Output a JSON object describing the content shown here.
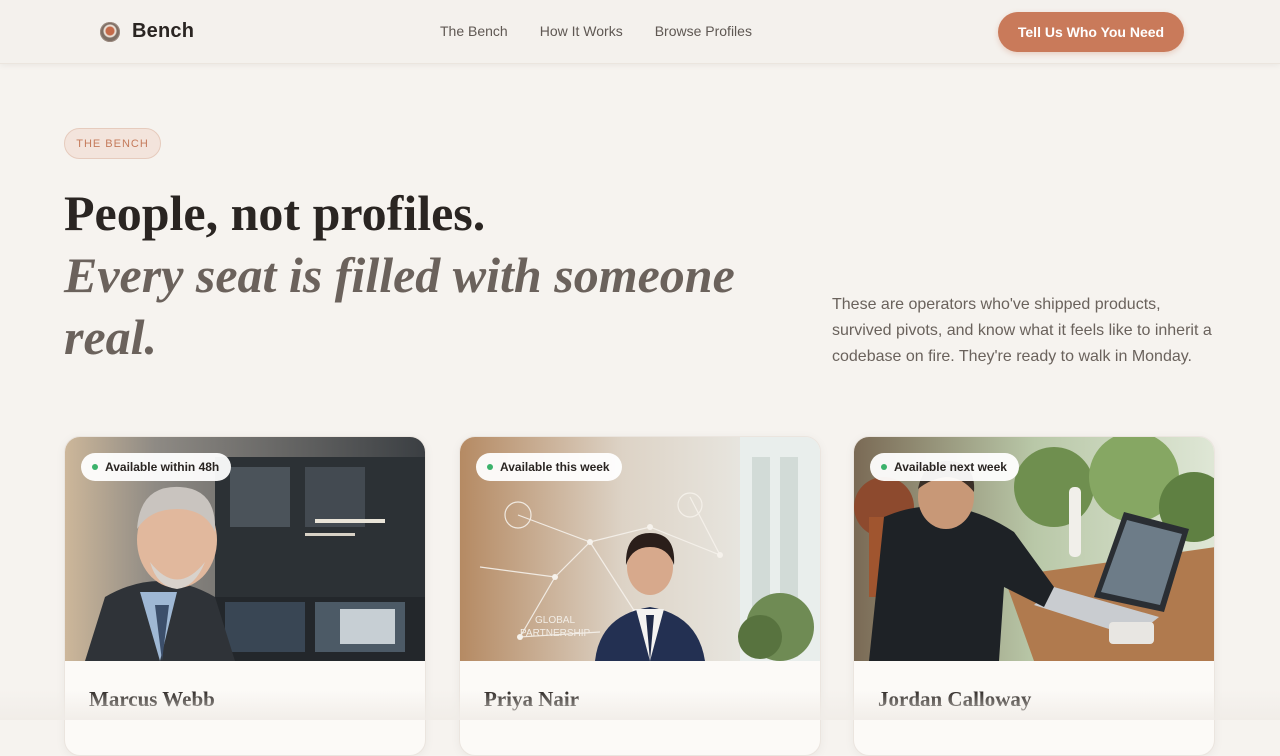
{
  "nav": {
    "brand": "Bench",
    "links": [
      "The Bench",
      "How It Works",
      "Browse Profiles"
    ],
    "cta": "Tell Us Who You Need"
  },
  "hero": {
    "eyebrow": "THE BENCH",
    "headline": "People, not profiles.",
    "subheadline": "Every seat is filled with someone real.",
    "lede": "These are operators who've shipped products, survived pivots, and know what it feels like to inherit a codebase on fire. They're ready to walk in Monday."
  },
  "cards": [
    {
      "badge": "Available within 48h",
      "name": "Marcus Webb"
    },
    {
      "badge": "Available this week",
      "name": "Priya Nair"
    },
    {
      "badge": "Available next week",
      "name": "Jordan Calloway"
    }
  ],
  "colors": {
    "accent": "#c97a5a",
    "background": "#f6f3ef",
    "available": "#3bb26b"
  },
  "icons": {
    "brand": "bench-logo-icon",
    "status": "status-dot-icon"
  }
}
